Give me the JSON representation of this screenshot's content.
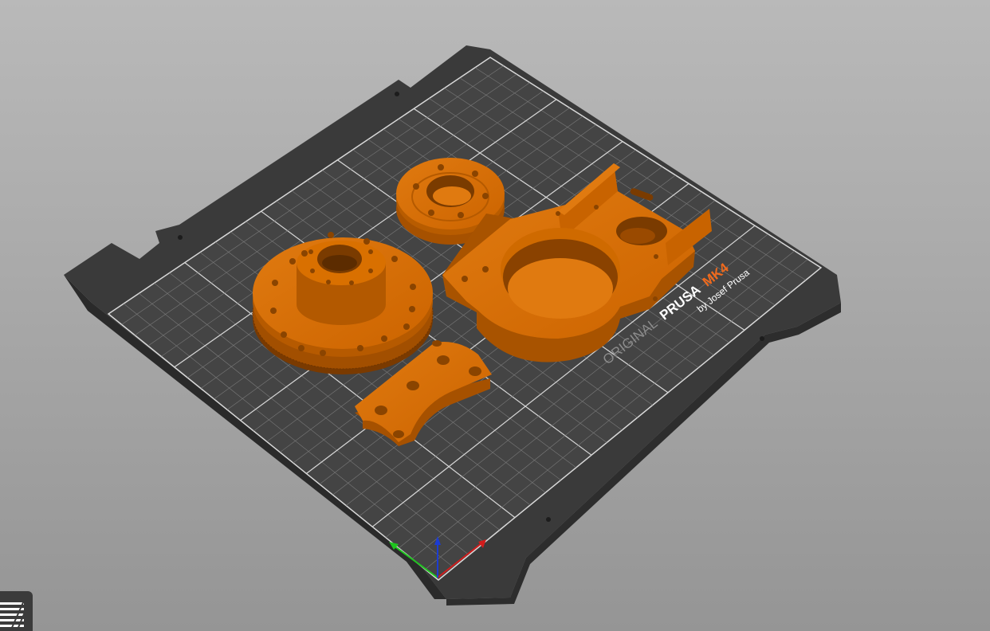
{
  "app": "PrusaSlicer 3D view",
  "bed": {
    "logo_prefix": "ORIGINAL",
    "logo_brand": "PRUSA",
    "logo_model": "MK4",
    "logo_byline": "by Josef Prusa",
    "color_plate": "#3a3a3a",
    "color_grid": "#ffffff",
    "color_accent": "#f06a1d"
  },
  "objects": [
    {
      "name": "gear-hub-part",
      "color": "#d46a00"
    },
    {
      "name": "bearing-ring-part",
      "color": "#d46a00"
    },
    {
      "name": "motor-mount-housing",
      "color": "#d46a00"
    },
    {
      "name": "arc-bracket-part",
      "color": "#d46a00"
    }
  ],
  "axes": {
    "x_color": "#d11c1c",
    "y_color": "#1ec51e",
    "z_color": "#1c3cd1"
  },
  "toolbar": {
    "layers_icon": "layers-icon"
  }
}
